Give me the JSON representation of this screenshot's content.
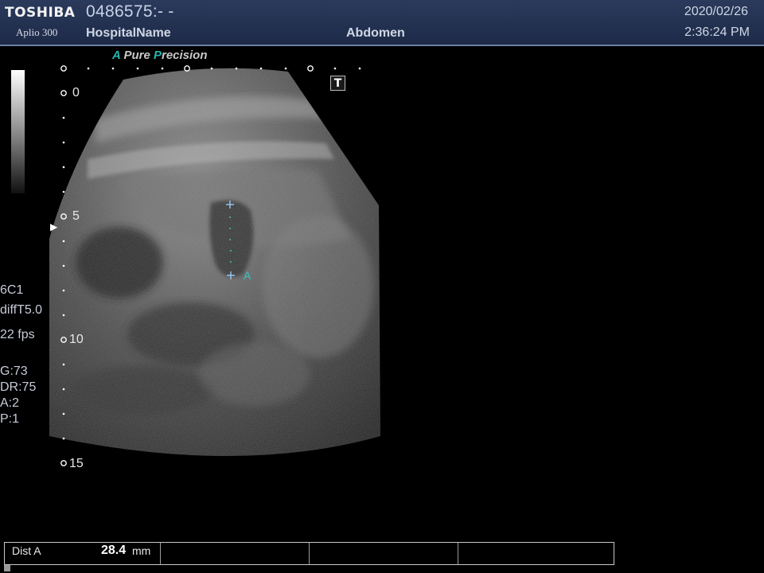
{
  "header": {
    "brand": "TOSHIBA",
    "model": "Aplio 300",
    "patient_id": "0486575:- -",
    "hospital": "HospitalName",
    "exam": "Abdomen",
    "date": "2020/02/26",
    "time": "2:36:24 PM"
  },
  "image": {
    "tagline_a": "A",
    "tagline_pure": " Pure ",
    "tagline_p": "P",
    "tagline_rest": "recision",
    "depth_scale": [
      "0",
      "5",
      "10",
      "15"
    ],
    "focus_marker": "▶",
    "text_badge": "T",
    "caliper_label": "A"
  },
  "params": {
    "probe": "6C1",
    "mode": "diffT5.0",
    "frame_rate": "22 fps",
    "gain": "G:73",
    "dynamic_range": "DR:75",
    "a": "A:2",
    "p": "P:1"
  },
  "measurement": {
    "label": "Dist A",
    "value": "28.4",
    "unit": "mm"
  },
  "colors": {
    "header": "#2b3a5c",
    "accent": "#25b5b0",
    "caliper": "#35c4c0"
  }
}
